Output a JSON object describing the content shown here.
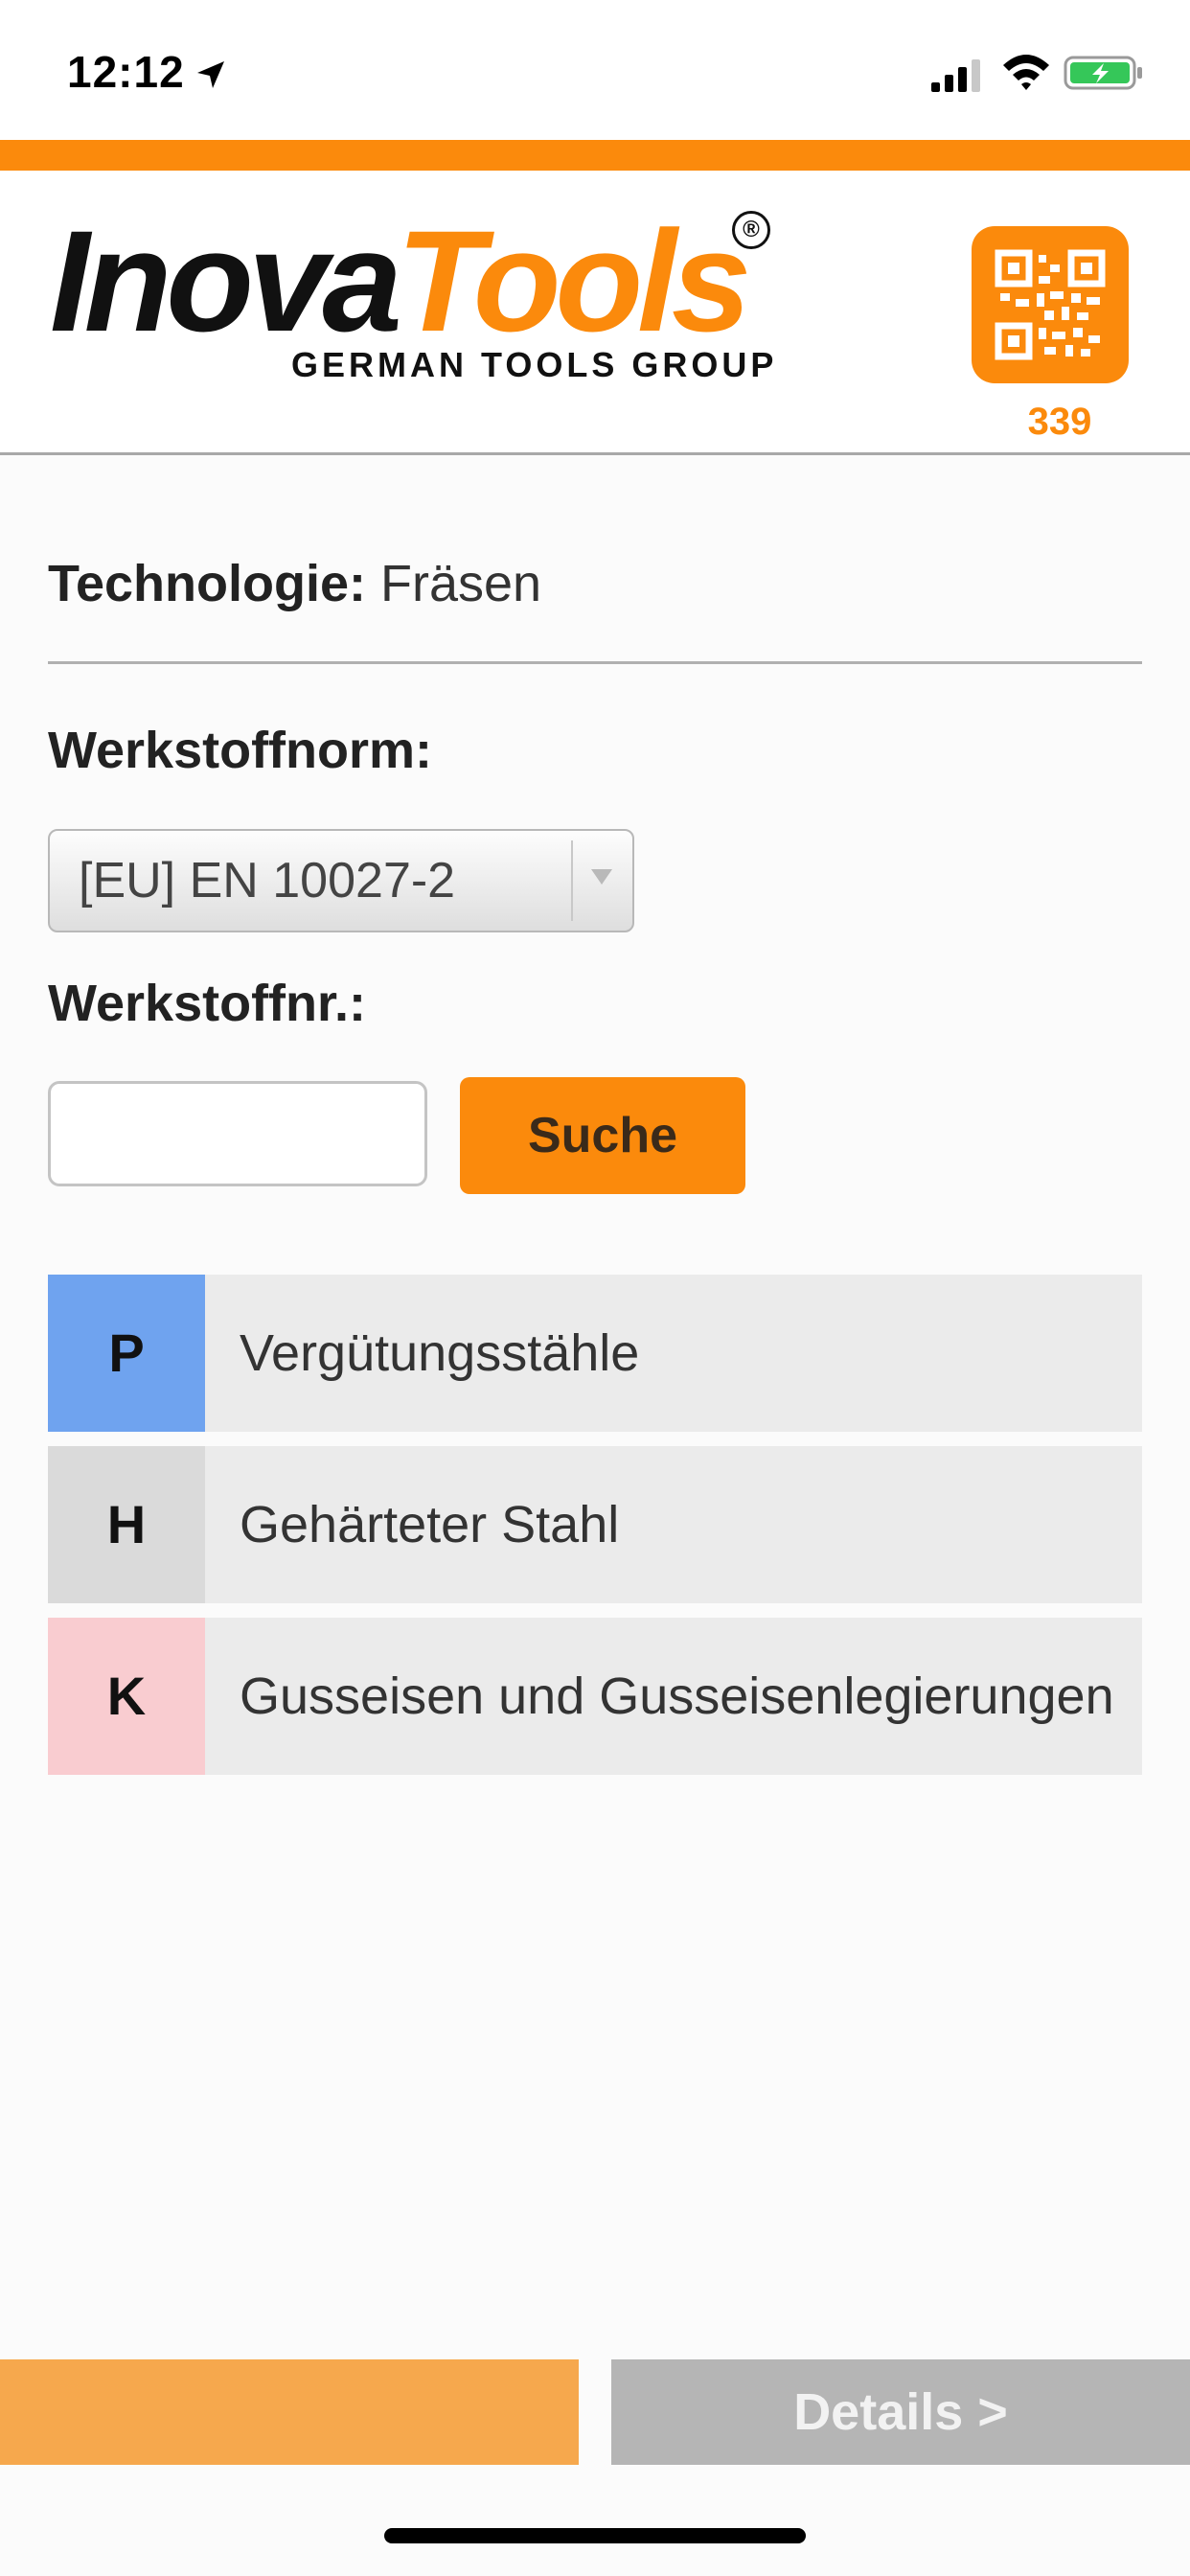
{
  "status_bar": {
    "time": "12:12"
  },
  "header": {
    "logo": {
      "part_black": "Inova",
      "part_orange": "Tools",
      "registered": "®",
      "subtitle": "GERMAN TOOLS GROUP"
    },
    "qr_count": "339",
    "colors": {
      "brand_orange": "#fb8a0c"
    }
  },
  "technology": {
    "label": "Technologie:",
    "value": "Fräsen"
  },
  "material_standard": {
    "label": "Werkstoffnorm:",
    "selected": "[EU] EN 10027-2"
  },
  "material_number": {
    "label": "Werkstoffnr.:",
    "value": "",
    "search_label": "Suche"
  },
  "materials": [
    {
      "code": "P",
      "name": "Vergütungsstähle",
      "color": "#6fa3ef"
    },
    {
      "code": "H",
      "name": "Gehärteter Stahl",
      "color": "#dadada"
    },
    {
      "code": "K",
      "name": "Gusseisen und Gusseisenlegierungen",
      "color": "#f9ccd0"
    }
  ],
  "footer": {
    "details_label": "Details >"
  }
}
